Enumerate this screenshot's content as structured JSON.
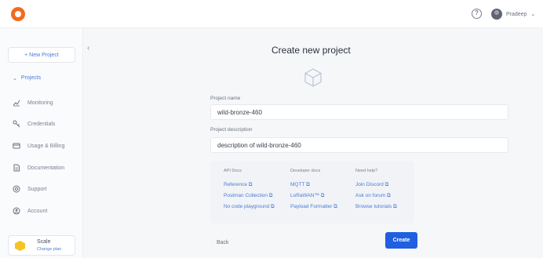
{
  "header": {
    "user_name": "Pradeep",
    "logo_icon": "orange-circle-logo",
    "help_icon": "question-circle-icon"
  },
  "sidebar": {
    "new_project_label": "+ New Project",
    "projects_label": "Projects",
    "items": [
      {
        "label": "Monitoring",
        "icon": "chart-line-icon"
      },
      {
        "label": "Credentials",
        "icon": "key-icon"
      },
      {
        "label": "Usage & Billing",
        "icon": "card-icon"
      },
      {
        "label": "Documentation",
        "icon": "document-icon"
      },
      {
        "label": "Support",
        "icon": "support-icon"
      },
      {
        "label": "Account",
        "icon": "account-icon"
      }
    ],
    "plan": {
      "name": "Scale",
      "action": "Change plan"
    }
  },
  "form": {
    "title": "Create new project",
    "project_name_label": "Project name",
    "project_name_value": "wild-bronze-460",
    "description_label": "Project description",
    "description_value": "description of wild-bronze-460",
    "back_label": "Back",
    "create_label": "Create"
  },
  "resources": {
    "columns": [
      {
        "title": "API Docs",
        "links": [
          "Reference ⧉",
          "Postman Collection ⧉",
          "No code playground ⧉"
        ]
      },
      {
        "title": "Developer docs",
        "links": [
          "MQTT ⧉",
          "LoRaWAN™ ⧉",
          "Payload Formatter ⧉"
        ]
      },
      {
        "title": "Need help?",
        "links": [
          "Join Discord ⧉",
          "Ask on forum ⧉",
          "Browse tutorials ⧉"
        ]
      }
    ]
  },
  "colors": {
    "brand": "#f26b1d",
    "primary": "#1f5fe0",
    "link": "#4a7bd9"
  }
}
